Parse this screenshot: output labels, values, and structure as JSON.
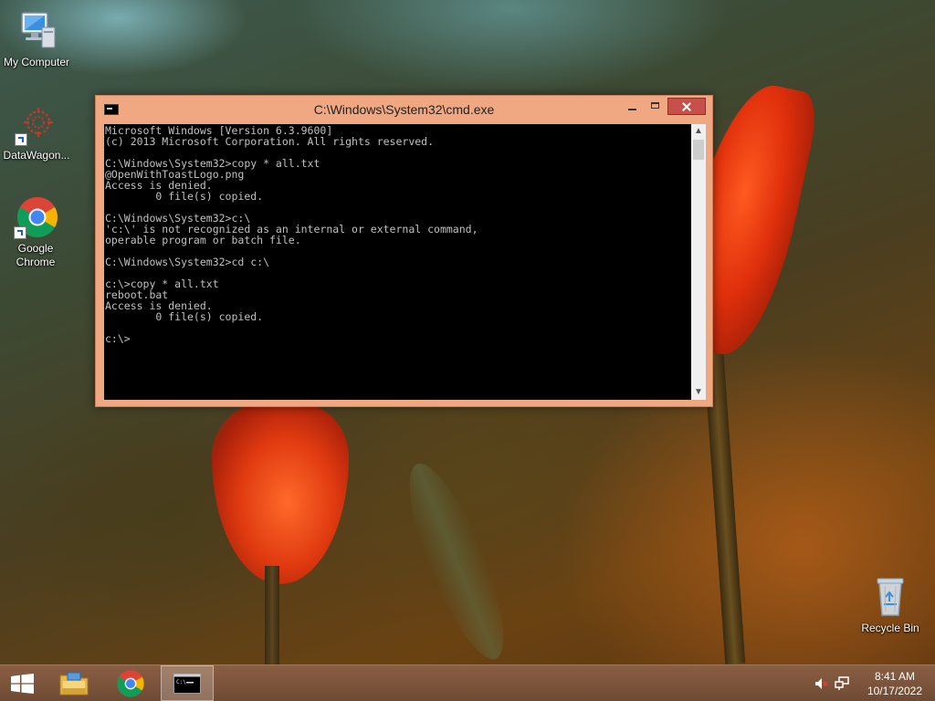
{
  "desktop": {
    "icons": [
      {
        "label": "My Computer"
      },
      {
        "label": "DataWagon..."
      },
      {
        "label": "Google Chrome"
      },
      {
        "label": "Recycle Bin"
      }
    ]
  },
  "cmd_window": {
    "title": "C:\\Windows\\System32\\cmd.exe",
    "lines": [
      "Microsoft Windows [Version 6.3.9600]",
      "(c) 2013 Microsoft Corporation. All rights reserved.",
      "",
      "C:\\Windows\\System32>copy * all.txt",
      "@OpenWithToastLogo.png",
      "Access is denied.",
      "        0 file(s) copied.",
      "",
      "C:\\Windows\\System32>c:\\",
      "'c:\\' is not recognized as an internal or external command,",
      "operable program or batch file.",
      "",
      "C:\\Windows\\System32>cd c:\\",
      "",
      "c:\\>copy * all.txt",
      "reboot.bat",
      "Access is denied.",
      "        0 file(s) copied.",
      "",
      "c:\\>"
    ]
  },
  "taskbar": {
    "clock_time": "8:41 AM",
    "clock_date": "10/17/2022"
  },
  "icons": {
    "start": "windows-logo-icon",
    "explorer": "file-explorer-icon",
    "chrome": "chrome-icon",
    "cmd": "command-prompt-icon",
    "volume": "speaker-muted-icon",
    "network": "network-icon"
  },
  "colors": {
    "window_frame": "#f0a882",
    "close_button": "#c7504a",
    "console_bg": "#000000",
    "console_text": "#c0c0c0",
    "taskbar": "#7a5440"
  }
}
